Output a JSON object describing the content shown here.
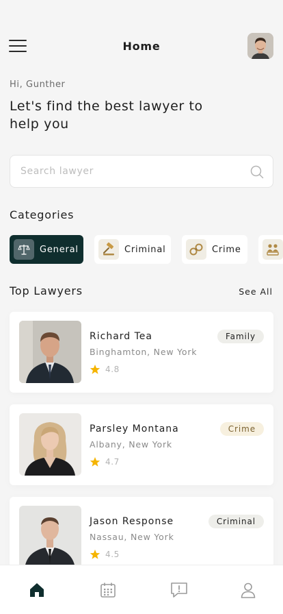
{
  "header": {
    "title": "Home",
    "menu_icon": "hamburger-menu-icon",
    "avatar_alt": "user avatar"
  },
  "greeting": "Hi, Gunther",
  "headline": "Let's find the best lawyer to help you",
  "search": {
    "placeholder": "Search lawyer",
    "value": "",
    "icon": "search-icon"
  },
  "categories": {
    "title": "Categories",
    "items": [
      {
        "label": "General",
        "icon": "scales-icon",
        "active": true
      },
      {
        "label": "Criminal",
        "icon": "gavel-icon",
        "active": false
      },
      {
        "label": "Crime",
        "icon": "handcuffs-icon",
        "active": false
      },
      {
        "label": "",
        "icon": "family-icon",
        "active": false
      }
    ]
  },
  "top_lawyers": {
    "title": "Top Lawyers",
    "see_all": "See All",
    "items": [
      {
        "name": "Richard Tea",
        "location": "Binghamton, New York",
        "rating": "4.8",
        "category": "Family"
      },
      {
        "name": "Parsley Montana",
        "location": "Albany, New York",
        "rating": "4.7",
        "category": "Crime"
      },
      {
        "name": "Jason Response",
        "location": "Nassau, New York",
        "rating": "4.5",
        "category": "Criminal"
      }
    ]
  },
  "bottom_nav": {
    "items": [
      {
        "icon": "home-icon",
        "active": true
      },
      {
        "icon": "calendar-icon",
        "active": false
      },
      {
        "icon": "chat-alert-icon",
        "active": false
      },
      {
        "icon": "user-profile-icon",
        "active": false
      }
    ]
  },
  "colors": {
    "primary": "#0f2e2e",
    "background": "#f5f5f5",
    "card": "#ffffff",
    "star": "#f5b400",
    "crime_badge_bg": "#f7f0df",
    "crime_badge_text": "#7b6230"
  }
}
